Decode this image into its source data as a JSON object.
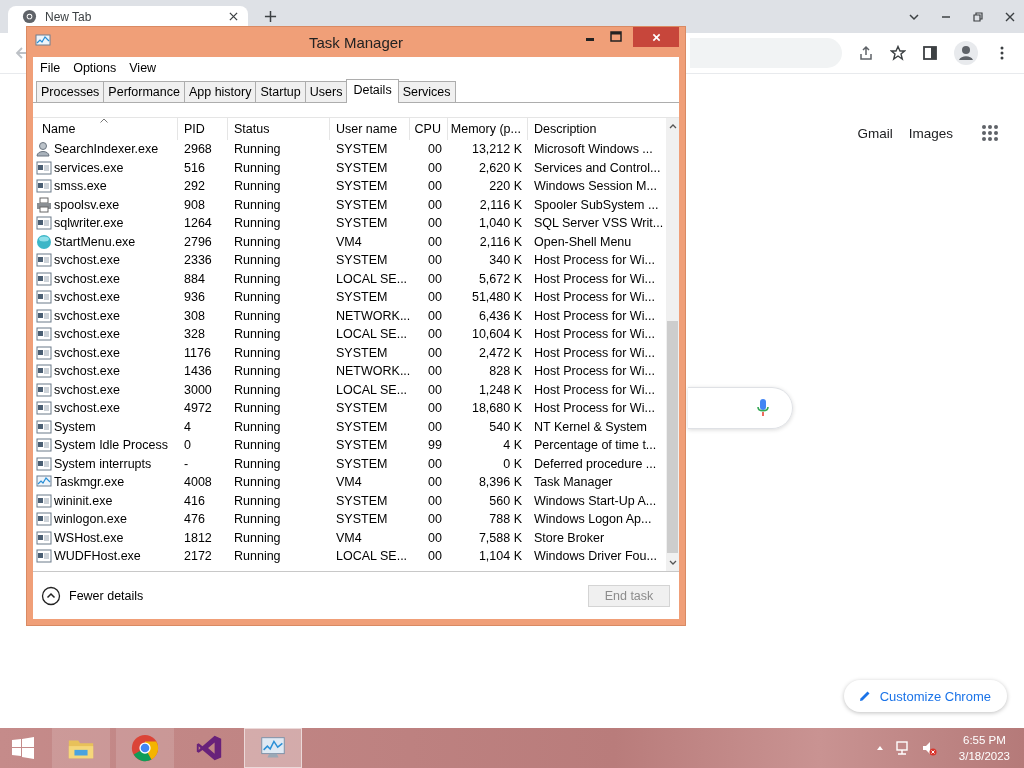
{
  "browser": {
    "tab_title": "New Tab",
    "links": [
      "Gmail",
      "Images"
    ],
    "customize_button": "Customize Chrome"
  },
  "task_manager": {
    "title": "Task Manager",
    "menu": [
      "File",
      "Options",
      "View"
    ],
    "tabs": [
      {
        "label": "Processes",
        "selected": false
      },
      {
        "label": "Performance",
        "selected": false
      },
      {
        "label": "App history",
        "selected": false
      },
      {
        "label": "Startup",
        "selected": false
      },
      {
        "label": "Users",
        "selected": false
      },
      {
        "label": "Details",
        "selected": true
      },
      {
        "label": "Services",
        "selected": false
      }
    ],
    "columns": [
      {
        "label": "Name",
        "sorted": true
      },
      {
        "label": "PID",
        "sorted": false
      },
      {
        "label": "Status",
        "sorted": false
      },
      {
        "label": "User name",
        "sorted": false
      },
      {
        "label": "CPU",
        "sorted": false
      },
      {
        "label": "Memory (p...",
        "sorted": false
      },
      {
        "label": "Description",
        "sorted": false
      }
    ],
    "rows": [
      {
        "kind": "search",
        "name": "SearchIndexer.exe",
        "pid": "2968",
        "status": "Running",
        "user": "SYSTEM",
        "cpu": "00",
        "memory": "13,212 K",
        "description": "Microsoft Windows ..."
      },
      {
        "kind": "app",
        "name": "services.exe",
        "pid": "516",
        "status": "Running",
        "user": "SYSTEM",
        "cpu": "00",
        "memory": "2,620 K",
        "description": "Services and Control..."
      },
      {
        "kind": "app",
        "name": "smss.exe",
        "pid": "292",
        "status": "Running",
        "user": "SYSTEM",
        "cpu": "00",
        "memory": "220 K",
        "description": "Windows Session M..."
      },
      {
        "kind": "printer",
        "name": "spoolsv.exe",
        "pid": "908",
        "status": "Running",
        "user": "SYSTEM",
        "cpu": "00",
        "memory": "2,116 K",
        "description": "Spooler SubSystem ..."
      },
      {
        "kind": "app",
        "name": "sqlwriter.exe",
        "pid": "1264",
        "status": "Running",
        "user": "SYSTEM",
        "cpu": "00",
        "memory": "1,040 K",
        "description": "SQL Server VSS Writ..."
      },
      {
        "kind": "globe",
        "name": "StartMenu.exe",
        "pid": "2796",
        "status": "Running",
        "user": "VM4",
        "cpu": "00",
        "memory": "2,116 K",
        "description": "Open-Shell Menu"
      },
      {
        "kind": "app",
        "name": "svchost.exe",
        "pid": "2336",
        "status": "Running",
        "user": "SYSTEM",
        "cpu": "00",
        "memory": "340 K",
        "description": "Host Process for Wi..."
      },
      {
        "kind": "app",
        "name": "svchost.exe",
        "pid": "884",
        "status": "Running",
        "user": "LOCAL SE...",
        "cpu": "00",
        "memory": "5,672 K",
        "description": "Host Process for Wi..."
      },
      {
        "kind": "app",
        "name": "svchost.exe",
        "pid": "936",
        "status": "Running",
        "user": "SYSTEM",
        "cpu": "00",
        "memory": "51,480 K",
        "description": "Host Process for Wi..."
      },
      {
        "kind": "app",
        "name": "svchost.exe",
        "pid": "308",
        "status": "Running",
        "user": "NETWORK...",
        "cpu": "00",
        "memory": "6,436 K",
        "description": "Host Process for Wi..."
      },
      {
        "kind": "app",
        "name": "svchost.exe",
        "pid": "328",
        "status": "Running",
        "user": "LOCAL SE...",
        "cpu": "00",
        "memory": "10,604 K",
        "description": "Host Process for Wi..."
      },
      {
        "kind": "app",
        "name": "svchost.exe",
        "pid": "1176",
        "status": "Running",
        "user": "SYSTEM",
        "cpu": "00",
        "memory": "2,472 K",
        "description": "Host Process for Wi..."
      },
      {
        "kind": "app",
        "name": "svchost.exe",
        "pid": "1436",
        "status": "Running",
        "user": "NETWORK...",
        "cpu": "00",
        "memory": "828 K",
        "description": "Host Process for Wi..."
      },
      {
        "kind": "app",
        "name": "svchost.exe",
        "pid": "3000",
        "status": "Running",
        "user": "LOCAL SE...",
        "cpu": "00",
        "memory": "1,248 K",
        "description": "Host Process for Wi..."
      },
      {
        "kind": "app",
        "name": "svchost.exe",
        "pid": "4972",
        "status": "Running",
        "user": "SYSTEM",
        "cpu": "00",
        "memory": "18,680 K",
        "description": "Host Process for Wi..."
      },
      {
        "kind": "app",
        "name": "System",
        "pid": "4",
        "status": "Running",
        "user": "SYSTEM",
        "cpu": "00",
        "memory": "540 K",
        "description": "NT Kernel & System"
      },
      {
        "kind": "app",
        "name": "System Idle Process",
        "pid": "0",
        "status": "Running",
        "user": "SYSTEM",
        "cpu": "99",
        "memory": "4 K",
        "description": "Percentage of time t..."
      },
      {
        "kind": "app",
        "name": "System interrupts",
        "pid": "-",
        "status": "Running",
        "user": "SYSTEM",
        "cpu": "00",
        "memory": "0 K",
        "description": "Deferred procedure ..."
      },
      {
        "kind": "monitor",
        "name": "Taskmgr.exe",
        "pid": "4008",
        "status": "Running",
        "user": "VM4",
        "cpu": "00",
        "memory": "8,396 K",
        "description": "Task Manager"
      },
      {
        "kind": "app",
        "name": "wininit.exe",
        "pid": "416",
        "status": "Running",
        "user": "SYSTEM",
        "cpu": "00",
        "memory": "560 K",
        "description": "Windows Start-Up A..."
      },
      {
        "kind": "app",
        "name": "winlogon.exe",
        "pid": "476",
        "status": "Running",
        "user": "SYSTEM",
        "cpu": "00",
        "memory": "788 K",
        "description": "Windows Logon Ap..."
      },
      {
        "kind": "app",
        "name": "WSHost.exe",
        "pid": "1812",
        "status": "Running",
        "user": "VM4",
        "cpu": "00",
        "memory": "7,588 K",
        "description": "Store Broker"
      },
      {
        "kind": "app",
        "name": "WUDFHost.exe",
        "pid": "2172",
        "status": "Running",
        "user": "LOCAL SE...",
        "cpu": "00",
        "memory": "1,104 K",
        "description": "Windows Driver Fou..."
      }
    ],
    "fewer_details": "Fewer details",
    "end_task": {
      "label": "End task",
      "disabled": true
    }
  },
  "taskbar": {
    "apps": [
      {
        "kind": "explorer",
        "running": true,
        "selected": false
      },
      {
        "kind": "chrome",
        "running": true,
        "selected": false
      },
      {
        "kind": "studio",
        "running": false,
        "selected": false
      },
      {
        "kind": "taskmgr",
        "running": true,
        "selected": true
      }
    ],
    "time": "6:55 PM",
    "date": "3/18/2023"
  }
}
